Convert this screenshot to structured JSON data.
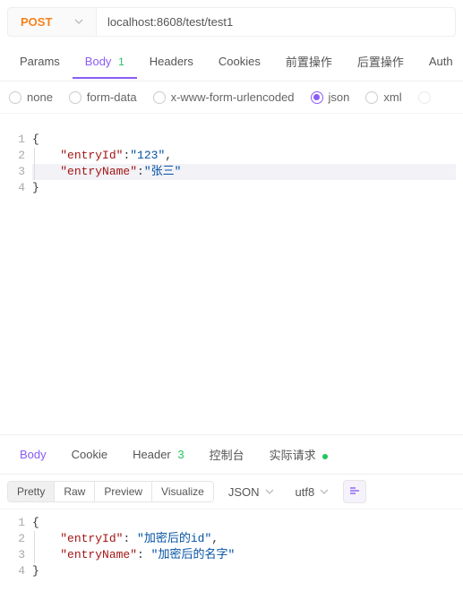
{
  "request": {
    "method": "POST",
    "url": "localhost:8608/test/test1"
  },
  "tabs": {
    "params": "Params",
    "body": "Body",
    "body_count": "1",
    "headers": "Headers",
    "cookies": "Cookies",
    "pre": "前置操作",
    "post": "后置操作",
    "auth": "Auth"
  },
  "body_types": {
    "none": "none",
    "formdata": "form-data",
    "xform": "x-www-form-urlencoded",
    "json": "json",
    "xml": "xml"
  },
  "request_code": {
    "l1_num": "1",
    "l2_num": "2",
    "l3_num": "3",
    "l4_num": "4",
    "l1": "{",
    "l2_key": "\"entryId\"",
    "l2_val": "\"123\"",
    "l3_key": "\"entryName\"",
    "l3_val": "\"张三\"",
    "l4": "}"
  },
  "response": {
    "tabs": {
      "body": "Body",
      "cookie": "Cookie",
      "header": "Header",
      "header_count": "3",
      "console": "控制台",
      "actual": "实际请求"
    },
    "toolbar": {
      "pretty": "Pretty",
      "raw": "Raw",
      "preview": "Preview",
      "visualize": "Visualize",
      "format": "JSON",
      "encoding": "utf8"
    },
    "code": {
      "l1_num": "1",
      "l2_num": "2",
      "l3_num": "3",
      "l4_num": "4",
      "l1": "{",
      "l2_key": "\"entryId\"",
      "l2_val": "\"加密后的id\"",
      "l3_key": "\"entryName\"",
      "l3_val": "\"加密后的名字\"",
      "l4": "}"
    }
  }
}
